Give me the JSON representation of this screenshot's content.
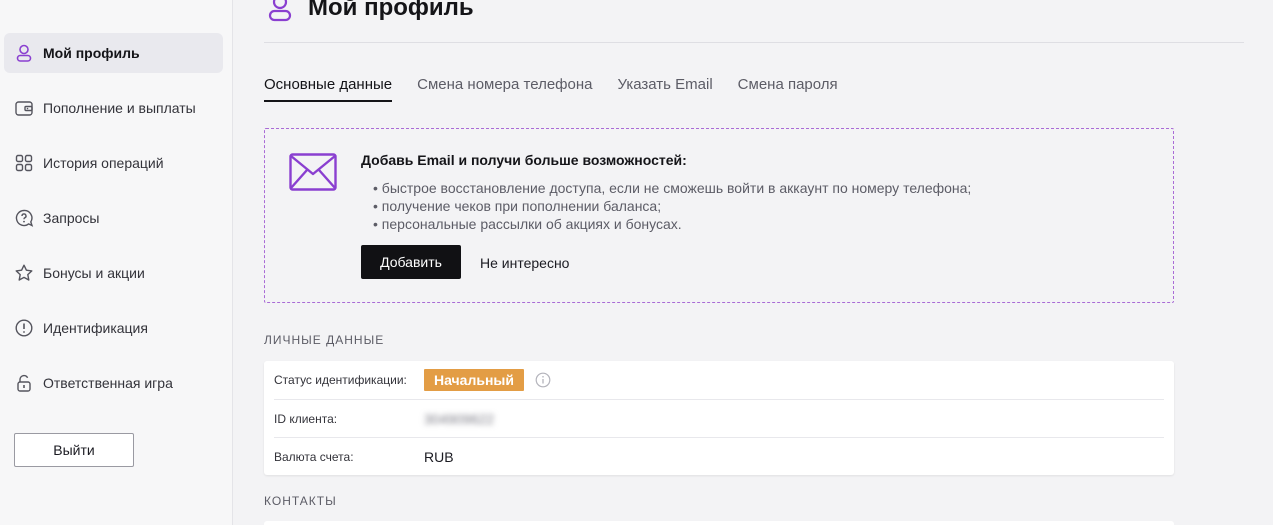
{
  "sidebar": {
    "items": [
      {
        "label": "Мой профиль",
        "icon": "user-icon",
        "active": true
      },
      {
        "label": "Пополнение и выплаты",
        "icon": "wallet-icon",
        "active": false
      },
      {
        "label": "История операций",
        "icon": "grid-icon",
        "active": false
      },
      {
        "label": "Запросы",
        "icon": "question-icon",
        "active": false
      },
      {
        "label": "Бонусы и акции",
        "icon": "star-icon",
        "active": false
      },
      {
        "label": "Идентификация",
        "icon": "exclamation-icon",
        "active": false
      },
      {
        "label": "Ответственная игра",
        "icon": "lock-icon",
        "active": false
      }
    ],
    "logout_label": "Выйти"
  },
  "header": {
    "title": "Мой профиль",
    "icon": "user-icon"
  },
  "tabs": [
    {
      "label": "Основные данные",
      "active": true
    },
    {
      "label": "Смена номера телефона",
      "active": false
    },
    {
      "label": "Указать Email",
      "active": false
    },
    {
      "label": "Смена пароля",
      "active": false
    }
  ],
  "promo": {
    "icon": "envelope-icon",
    "title": "Добавь Email и получи больше возможностей:",
    "benefits": [
      "быстрое восстановление доступа, если не сможешь войти в аккаунт по номеру телефона;",
      "получение чеков при пополнении баланса;",
      "персональные рассылки об акциях и бонусах."
    ],
    "add_label": "Добавить",
    "dismiss_label": "Не интересно"
  },
  "personal": {
    "section_title": "ЛИЧНЫЕ ДАННЫЕ",
    "status_label": "Статус идентификации:",
    "status_value": "Начальный",
    "client_id_label": "ID клиента:",
    "client_id_value": "304909622",
    "currency_label": "Валюта счета:",
    "currency_value": "RUB"
  },
  "contacts": {
    "section_title": "КОНТАКТЫ"
  },
  "colors": {
    "accent": "#8a3fd0",
    "badge": "#e39d45",
    "button_dark": "#111114"
  }
}
